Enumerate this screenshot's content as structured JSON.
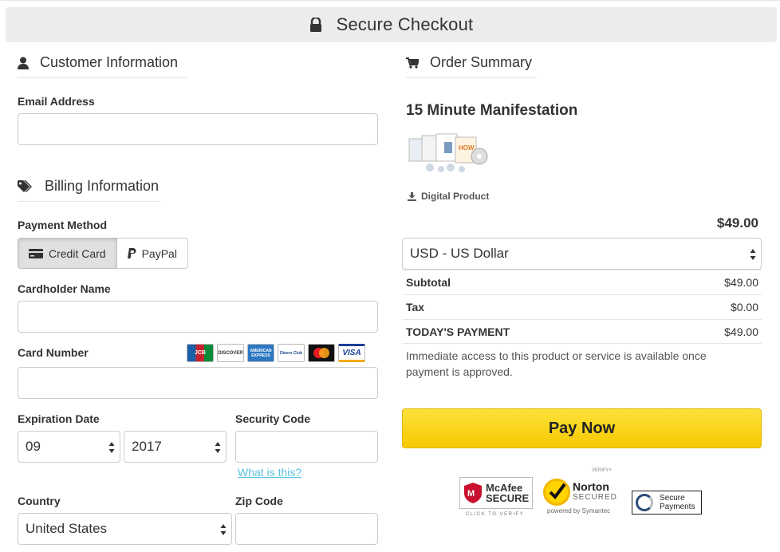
{
  "header": {
    "title": "Secure Checkout",
    "icon": "lock-icon"
  },
  "customer": {
    "heading": "Customer Information",
    "email_label": "Email Address",
    "email_value": ""
  },
  "billing": {
    "heading": "Billing Information",
    "payment_method_label": "Payment Method",
    "methods": [
      {
        "label": "Credit Card",
        "active": true
      },
      {
        "label": "PayPal",
        "active": false
      }
    ],
    "cardholder_label": "Cardholder Name",
    "card_number_label": "Card Number",
    "card_brands": [
      "JCB",
      "DISCOVER",
      "AMERICAN EXPRESS",
      "Diners Club",
      "mastercard",
      "VISA"
    ],
    "expiration_label": "Expiration Date",
    "exp_month": "09",
    "exp_year": "2017",
    "security_label": "Security Code",
    "what_is_this": "What is this?",
    "country_label": "Country",
    "country_value": "United States",
    "zip_label": "Zip Code"
  },
  "order": {
    "heading": "Order Summary",
    "product_title": "15 Minute Manifestation",
    "product_type": "Digital Product",
    "price": "$49.00",
    "currency": "USD - US Dollar",
    "rows": [
      {
        "k": "Subtotal",
        "v": "$49.00"
      },
      {
        "k": "Tax",
        "v": "$0.00"
      },
      {
        "k": "TODAY'S PAYMENT",
        "v": "$49.00"
      }
    ],
    "notice": "Immediate access to this product or service is available once payment is approved.",
    "pay_button": "Pay Now"
  },
  "badges": {
    "mcafee_line1": "McAfee",
    "mcafee_line2": "SECURE",
    "mcafee_sub": "CLICK TO VERIFY",
    "norton_verify": "VERIFY+",
    "norton_big": "Norton",
    "norton_small": "SECURED",
    "norton_sub": "powered by Symantec",
    "secure_line1": "Secure",
    "secure_line2": "Payments"
  },
  "colors": {
    "accent_link": "#5bc0de",
    "pay_button": "#f9d51c",
    "header_bg": "#ececec"
  }
}
